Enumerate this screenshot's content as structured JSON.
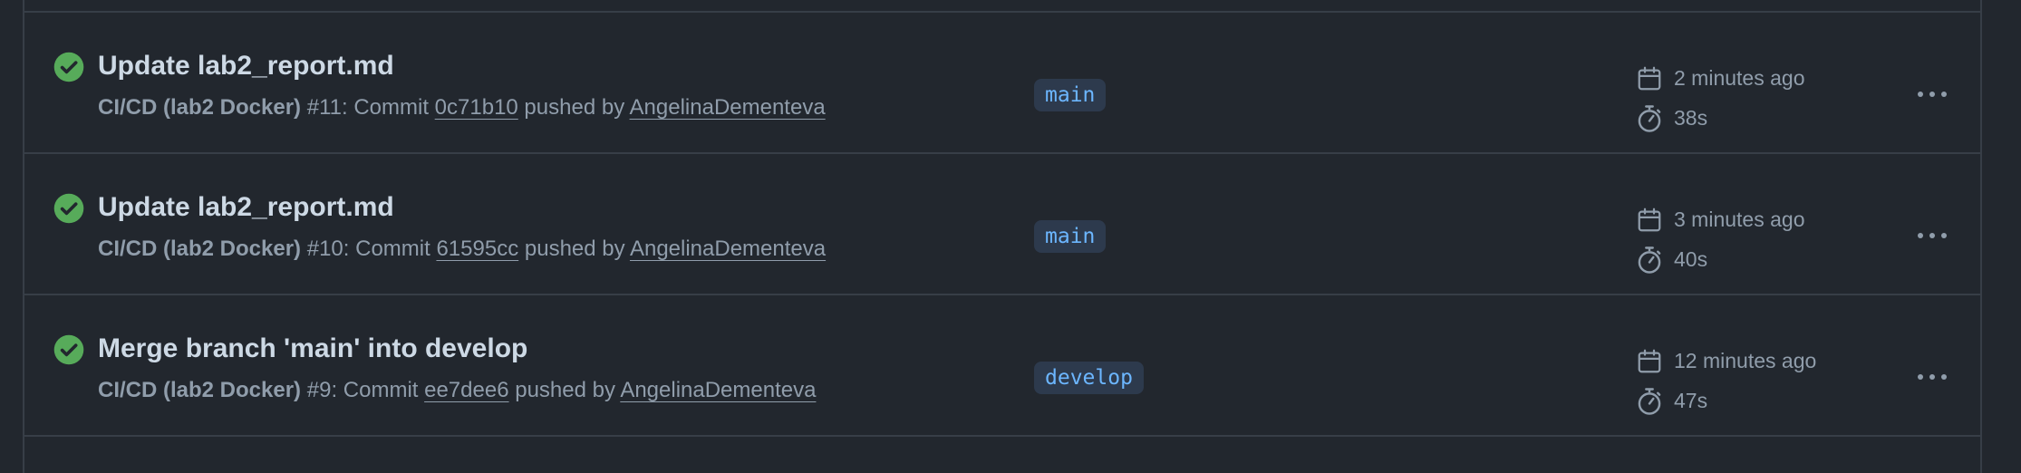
{
  "runs": [
    {
      "status": "success",
      "title": "Update lab2_report.md",
      "workflow": "CI/CD (lab2 Docker)",
      "run_number": "#11",
      "commit_prefix": ": Commit ",
      "commit_sha": "0c71b10",
      "pushed_by_text": " pushed by ",
      "actor": "AngelinaDementeva",
      "branch": "main",
      "time_ago": "2 minutes ago",
      "duration": "38s"
    },
    {
      "status": "success",
      "title": "Update lab2_report.md",
      "workflow": "CI/CD (lab2 Docker)",
      "run_number": "#10",
      "commit_prefix": ": Commit ",
      "commit_sha": "61595cc",
      "pushed_by_text": " pushed by ",
      "actor": "AngelinaDementeva",
      "branch": "main",
      "time_ago": "3 minutes ago",
      "duration": "40s"
    },
    {
      "status": "success",
      "title": "Merge branch 'main' into develop",
      "workflow": "CI/CD (lab2 Docker)",
      "run_number": "#9",
      "commit_prefix": ": Commit ",
      "commit_sha": "ee7dee6",
      "pushed_by_text": " pushed by ",
      "actor": "AngelinaDementeva",
      "branch": "develop",
      "time_ago": "12 minutes ago",
      "duration": "47s"
    }
  ],
  "icons": {
    "status": "check-circle-fill-icon",
    "calendar": "calendar-icon",
    "timer": "stopwatch-icon",
    "menu": "kebab-horizontal-icon"
  },
  "colors": {
    "background": "#22272e",
    "border": "#373e47",
    "success": "#57ab5a",
    "title": "#cdd9e5",
    "muted": "#909dab",
    "branch_text": "#6cb6ff",
    "branch_bg": "#2d3a4d"
  }
}
